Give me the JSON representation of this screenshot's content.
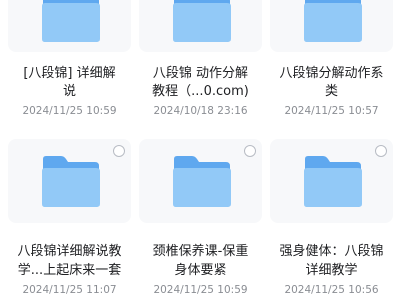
{
  "files": [
    {
      "name_line1": "[八段锦] 详细解",
      "name_line2": "说",
      "date": "2024/11/25 10:59",
      "icon": "folder-icon",
      "selectable": false
    },
    {
      "name_line1": "八段锦 动作分解",
      "name_line2": "教程（...0.com)",
      "date": "2024/10/18 23:16",
      "icon": "folder-icon",
      "selectable": false
    },
    {
      "name_line1": "八段锦分解动作系",
      "name_line2": "类",
      "date": "2024/11/25 10:57",
      "icon": "folder-icon",
      "selectable": false
    },
    {
      "name_line1": "八段锦详细解说教",
      "name_line2": "学...上起床来一套",
      "date": "2024/11/25 11:07",
      "icon": "folder-icon",
      "selectable": true
    },
    {
      "name_line1": "颈椎保养课-保重",
      "name_line2": "身体要紧",
      "date": "2024/11/25 10:59",
      "icon": "folder-icon",
      "selectable": true
    },
    {
      "name_line1": "强身健体：八段锦",
      "name_line2": "详细教学",
      "date": "2024/11/25 10:56",
      "icon": "folder-icon",
      "selectable": true
    }
  ],
  "colors": {
    "folder_back": "#5fa8ef",
    "folder_front": "#92c9f7",
    "card_bg": "#f7f8fa"
  }
}
